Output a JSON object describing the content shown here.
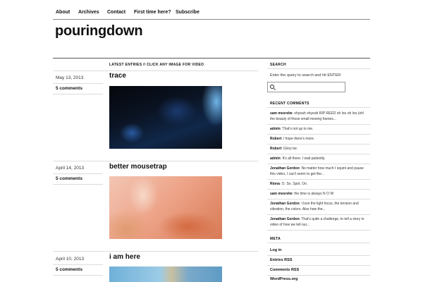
{
  "nav": {
    "items": [
      "About",
      "Archives",
      "Contact",
      "First time here?",
      "Subscribe"
    ]
  },
  "site": {
    "title": "pouringdown"
  },
  "main": {
    "heading": "LATEST ENTRIES // CLICK ANY IMAGE FOR VIDEO",
    "posts": [
      {
        "date": "May 13, 2013",
        "comments": "5 comments",
        "title": "trace"
      },
      {
        "date": "April 14, 2013",
        "comments": "5 comments",
        "title": "better mousetrap"
      },
      {
        "date": "April 10, 2013",
        "comments": "5 comments",
        "title": "i am here"
      }
    ]
  },
  "sidebar": {
    "search": {
      "heading": "SEARCH",
      "instructions": "Enter the query to search and hit ENTER:",
      "value": ""
    },
    "recent_comments": {
      "heading": "RECENT COMMENTS",
      "items": [
        {
          "author": "sam mesrelw",
          "text": ": ohyeah ohyeah RIP REED oh lou oh lou (oh! the beauty of those small moving frames..."
        },
        {
          "author": "admin",
          "text": ": That's not up to me."
        },
        {
          "author": "Robert",
          "text": ": I hope there's more."
        },
        {
          "author": "Robert",
          "text": ": Glory be."
        },
        {
          "author": "admin",
          "text": ": It's all there. I wait patiently."
        },
        {
          "author": "Jonathan Gordon",
          "text": ": No matter how much I squint and pause this video, I can't seem to get the..."
        },
        {
          "author": "Riona",
          "text": ": O. So. Spot. On."
        },
        {
          "author": "sam mesrelw",
          "text": ": the time is always N O W"
        },
        {
          "author": "Jonathan Gordon",
          "text": ": I love the light focus, the tension and vibration, the colors. Also how the..."
        },
        {
          "author": "Jonathan Gordon",
          "text": ": That's quite a challenge, to tell a story in video of how we tell our..."
        }
      ]
    },
    "meta": {
      "heading": "META",
      "links": [
        "Log in",
        "Entries RSS",
        "Comments RSS",
        "WordPress.org"
      ]
    }
  }
}
